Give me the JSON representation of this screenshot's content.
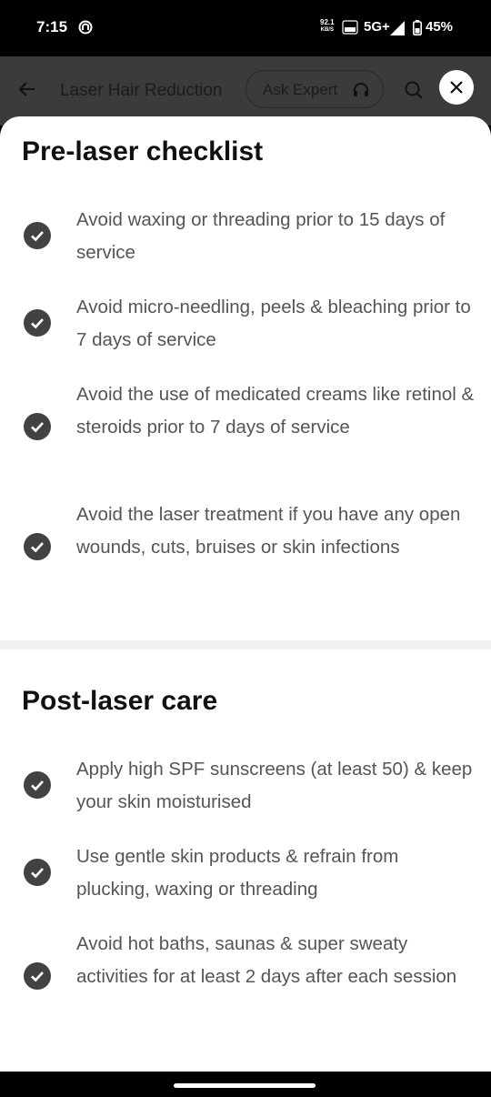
{
  "status_bar": {
    "time": "7:15",
    "speed_value": "92.1",
    "speed_unit": "KB/S",
    "network": "5G+",
    "battery": "45%"
  },
  "header": {
    "title": "Laser Hair Reduction",
    "ask_expert_label": "Ask Expert"
  },
  "pre_laser": {
    "title": "Pre-laser checklist",
    "items": [
      "Avoid waxing or threading prior to 15 days of service",
      "Avoid micro-needling, peels & bleaching prior to 7 days of service",
      "Avoid the use of medicated creams like retinol & steroids prior to 7 days of service",
      "Avoid the laser treatment if you have any open wounds, cuts, bruises or skin infections"
    ]
  },
  "post_laser": {
    "title": "Post-laser care",
    "items": [
      "Apply high SPF sunscreens (at least 50) & keep your skin moisturised",
      "Use gentle skin products & refrain from plucking, waxing or threading",
      "Avoid hot baths, saunas & super sweaty activities for at least 2 days after each session"
    ]
  },
  "colors": {
    "check_bg": "#424242",
    "text_secondary": "#555555",
    "header_dim": "#3b3b3b"
  }
}
